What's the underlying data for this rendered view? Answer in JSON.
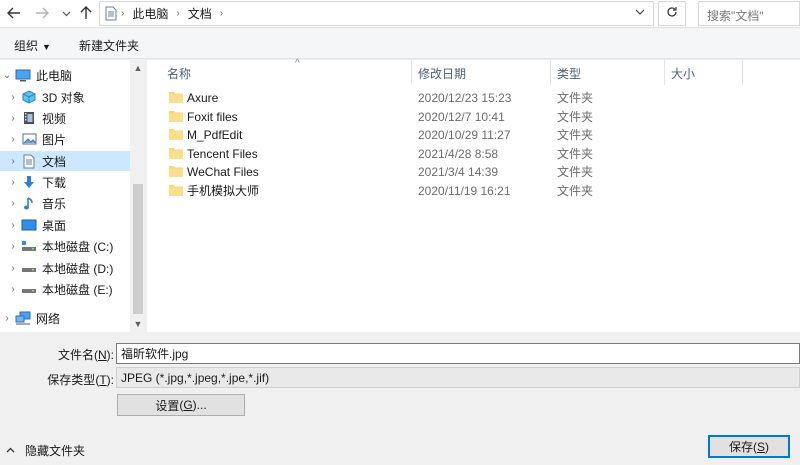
{
  "address_bar": {
    "back_icon": "arrow-left-icon",
    "breadcrumb": [
      "此电脑",
      "文档"
    ],
    "search_placeholder": "搜索\"文档\""
  },
  "toolbar": {
    "organize_label": "组织",
    "new_folder_label": "新建文件夹"
  },
  "nav_pane": {
    "items": [
      {
        "label": "此电脑",
        "icon": "computer-icon",
        "expanded": true
      },
      {
        "label": "3D 对象",
        "icon": "cube-3d-icon"
      },
      {
        "label": "视频",
        "icon": "video-icon"
      },
      {
        "label": "图片",
        "icon": "picture-icon"
      },
      {
        "label": "文档",
        "icon": "document-icon",
        "selected": true
      },
      {
        "label": "下载",
        "icon": "download-icon"
      },
      {
        "label": "音乐",
        "icon": "music-icon"
      },
      {
        "label": "桌面",
        "icon": "desktop-icon"
      },
      {
        "label": "本地磁盘 (C:)",
        "icon": "system-drive-icon"
      },
      {
        "label": "本地磁盘 (D:)",
        "icon": "drive-icon"
      },
      {
        "label": "本地磁盘 (E:)",
        "icon": "drive-icon"
      },
      {
        "label": "网络",
        "icon": "network-icon"
      }
    ]
  },
  "file_list": {
    "columns": [
      "名称",
      "修改日期",
      "类型",
      "大小"
    ],
    "rows": [
      {
        "name": "Axure",
        "date": "2020/12/23 15:23",
        "type": "文件夹"
      },
      {
        "name": "Foxit files",
        "date": "2020/12/7 10:41",
        "type": "文件夹"
      },
      {
        "name": "M_PdfEdit",
        "date": "2020/10/29 11:27",
        "type": "文件夹"
      },
      {
        "name": "Tencent Files",
        "date": "2021/4/28 8:58",
        "type": "文件夹"
      },
      {
        "name": "WeChat Files",
        "date": "2021/3/4 14:39",
        "type": "文件夹"
      },
      {
        "name": "手机模拟大师",
        "date": "2020/11/19 16:21",
        "type": "文件夹"
      }
    ]
  },
  "form": {
    "filename_label": "文件名",
    "filename_key": "N",
    "filename_value": "福昕软件.jpg",
    "filetype_label": "保存类型",
    "filetype_key": "T",
    "filetype_value": "JPEG (*.jpg,*.jpeg,*.jpe,*.jif)",
    "settings_label": "设置",
    "settings_key": "G",
    "hide_folders_label": "隐藏文件夹",
    "save_label": "保存",
    "save_key": "S"
  },
  "colors": {
    "selection": "#cce8ff",
    "folder": "#f8d775",
    "accent": "#0078d7"
  }
}
